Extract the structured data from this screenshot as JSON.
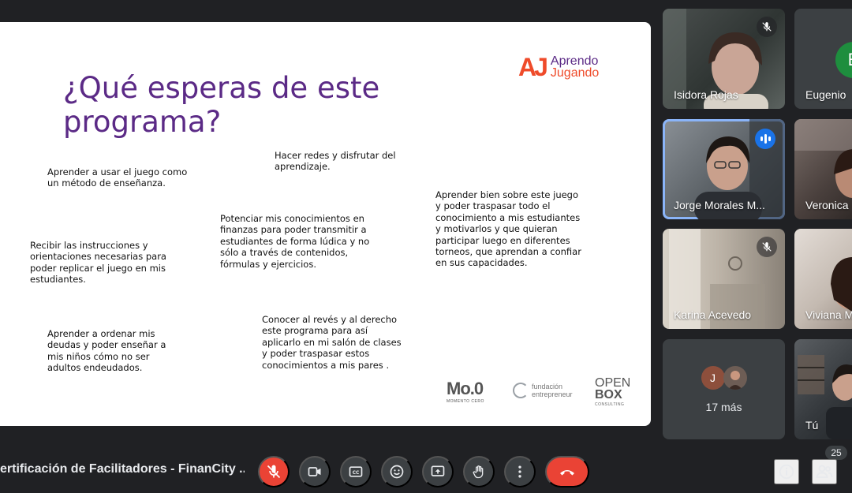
{
  "slide": {
    "title": "¿Qué esperas de este programa?",
    "brand": {
      "mark": "AJ",
      "line1": "Aprendo",
      "line2": "Jugando"
    },
    "notes": [
      "Aprender a usar el juego como un método de enseñanza.",
      "Hacer redes y disfrutar del aprendizaje.",
      "Aprender bien sobre este juego y poder traspasar todo el conocimiento a mis estudiantes y motivarlos y que quieran participar luego en diferentes torneos, que aprendan a confiar en sus capacidades.",
      "Potenciar mis conocimientos en finanzas para poder transmitir a estudiantes de forma lúdica y no sólo a través de contenidos, fórmulas y ejercicios.",
      "Recibir las instrucciones y orientaciones necesarias para poder replicar el juego en mis estudiantes.",
      "Aprender a ordenar mis deudas y poder enseñar a mis niños cómo no ser adultos endeudados.",
      "Conocer al revés y al derecho este programa para así aplicarlo en mi salón de clases y poder traspasar estos conocimientos a mis pares ."
    ],
    "partners": {
      "momento": "Mo.0",
      "momento_sub": "MOMENTO CERO",
      "fundacion_1": "fundación",
      "fundacion_2": "entrepreneur",
      "open_1": "OPEN",
      "open_2": "BOX",
      "open_sub": "CONSULTING"
    }
  },
  "participants": [
    {
      "name": "Isidora Rojas",
      "muted": true
    },
    {
      "name": "Eugenio",
      "avatar_letter": "E",
      "avatar_color": "#1e8e3e"
    },
    {
      "name": "Jorge Morales M...",
      "speaking": true
    },
    {
      "name": "Veronica"
    },
    {
      "name": "Karina Acevedo",
      "muted": true
    },
    {
      "name": "Viviana M"
    },
    {
      "name": "Tú"
    }
  ],
  "more_tile": {
    "avatar_letter": "J",
    "label": "17 más"
  },
  "meeting": {
    "title": "ertificación de Facilitadores - FinanCity ...",
    "participant_count": "25"
  },
  "colors": {
    "background": "#202124",
    "slide_title": "#5b2a86",
    "brand": "#ef4b2a",
    "danger": "#ea4335",
    "speaking": "#8ab4f8"
  },
  "controls": [
    "mic-off-icon",
    "camera-icon",
    "captions-icon",
    "emoji-icon",
    "present-icon",
    "raise-hand-icon",
    "more-vert-icon",
    "hangup-icon"
  ]
}
